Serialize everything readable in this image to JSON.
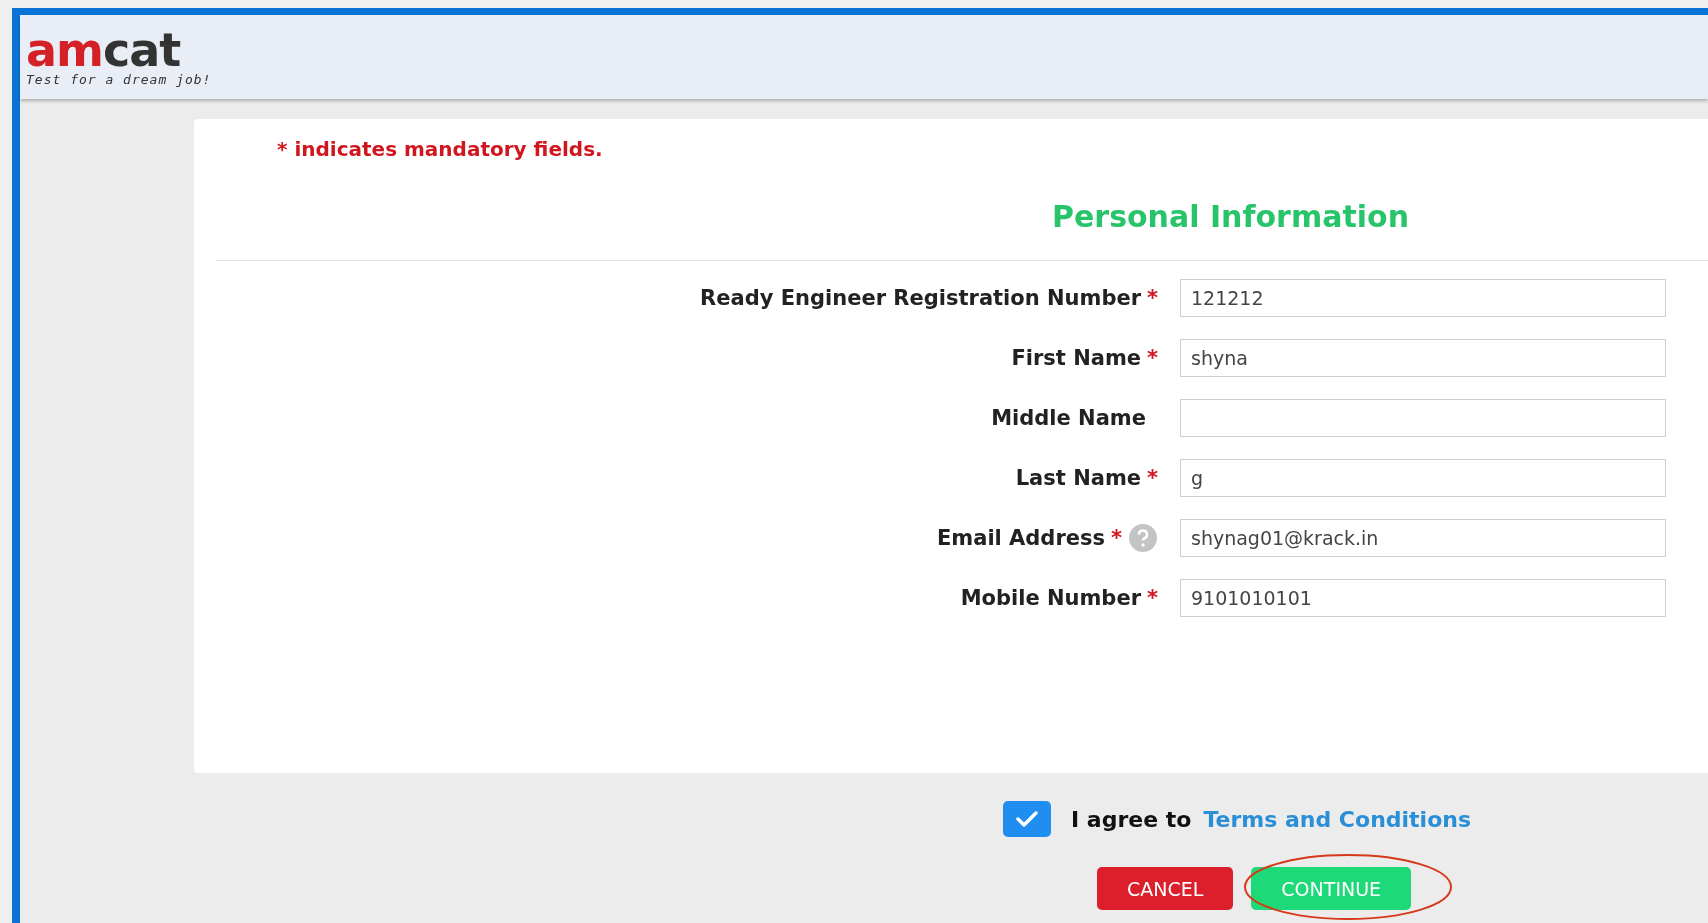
{
  "logo": {
    "primary": "am",
    "secondary": "cat",
    "tagline": "Test for a dream job!"
  },
  "notice": "* indicates mandatory fields.",
  "section_title": "Personal Information",
  "fields": [
    {
      "label": "Ready Engineer Registration Number",
      "required_mark": "*",
      "help": false,
      "value": "121212"
    },
    {
      "label": "First Name",
      "required_mark": "*",
      "help": false,
      "value": "shyna"
    },
    {
      "label": "Middle Name",
      "help": false
    },
    {
      "label": "Last Name",
      "required_mark": "*",
      "help": false,
      "value": "g"
    },
    {
      "label": "Email Address",
      "required_mark": "*",
      "help": true,
      "value": "shynag01@krack.in"
    },
    {
      "label": "Mobile Number",
      "required_mark": "*",
      "help": false,
      "value": "9101010101"
    }
  ],
  "agreement": {
    "checked": true,
    "text": "I agree to",
    "link": "Terms and Conditions"
  },
  "buttons": [
    {
      "kind": "cancel",
      "label": "CANCEL",
      "highlighted": false
    },
    {
      "kind": "continue",
      "label": "CONTINUE",
      "highlighted": true
    }
  ]
}
